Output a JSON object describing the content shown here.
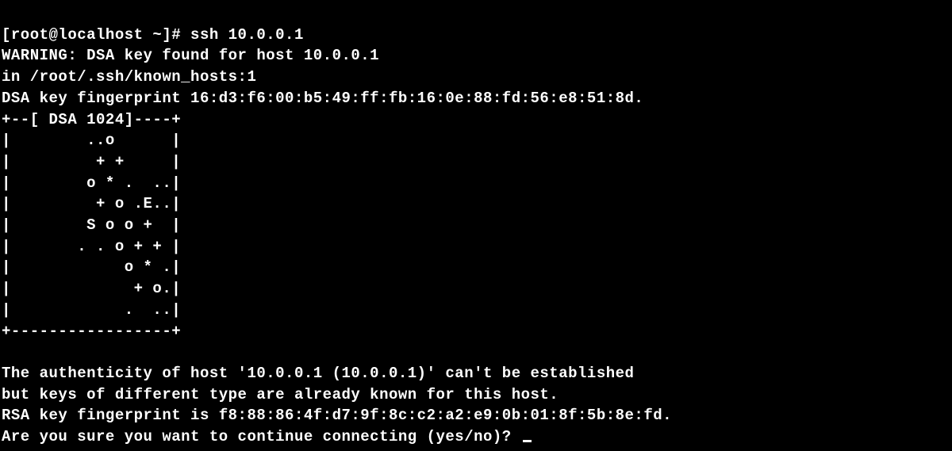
{
  "prompt": {
    "user": "root",
    "host": "localhost",
    "cwd": "~",
    "symbol": "#",
    "command": "ssh 10.0.0.1",
    "full": "[root@localhost ~]# ssh 10.0.0.1"
  },
  "warning": {
    "line1": "WARNING: DSA key found for host 10.0.0.1",
    "line2": "in /root/.ssh/known_hosts:1"
  },
  "dsa": {
    "fingerprint_line": "DSA key fingerprint 16:d3:f6:00:b5:49:ff:fb:16:0e:88:fd:56:e8:51:8d.",
    "fingerprint": "16:d3:f6:00:b5:49:ff:fb:16:0e:88:fd:56:e8:51:8d",
    "bits": 1024
  },
  "randomart": {
    "header": "+--[ DSA 1024]----+",
    "rows": [
      "|        ..o      |",
      "|         + +     |",
      "|        o * .  ..|",
      "|         + o .E..|",
      "|        S o o +  |",
      "|       . . o + + |",
      "|            o * .|",
      "|             + o.|",
      "|            .  ..|"
    ],
    "footer": "+-----------------+"
  },
  "blank": "",
  "auth": {
    "line1": "The authenticity of host '10.0.0.1 (10.0.0.1)' can't be established",
    "line2": "but keys of different type are already known for this host.",
    "rsa_line": "RSA key fingerprint is f8:88:86:4f:d7:9f:8c:c2:a2:e9:0b:01:8f:5b:8e:fd.",
    "rsa_fingerprint": "f8:88:86:4f:d7:9f:8c:c2:a2:e9:0b:01:8f:5b:8e:fd",
    "prompt": "Are you sure you want to continue connecting (yes/no)? "
  }
}
